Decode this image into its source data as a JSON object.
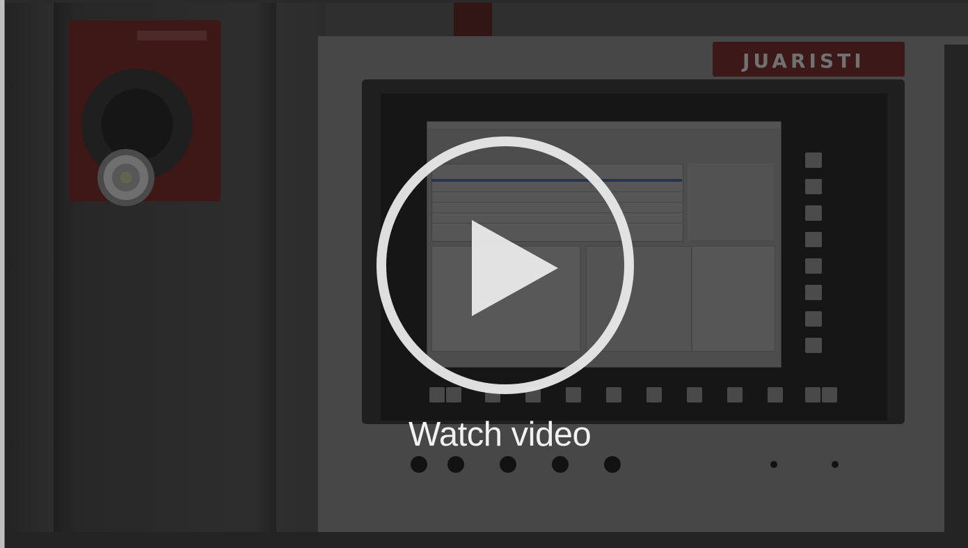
{
  "video": {
    "watch_label": "Watch video",
    "play_icon": "play-icon"
  },
  "machine": {
    "brand_plate": "JUARISTI"
  },
  "colors": {
    "overlay_text": "#f2f2f2",
    "play_button": "#ebebeb",
    "brand_plate_bg": "#4a1e1e"
  }
}
